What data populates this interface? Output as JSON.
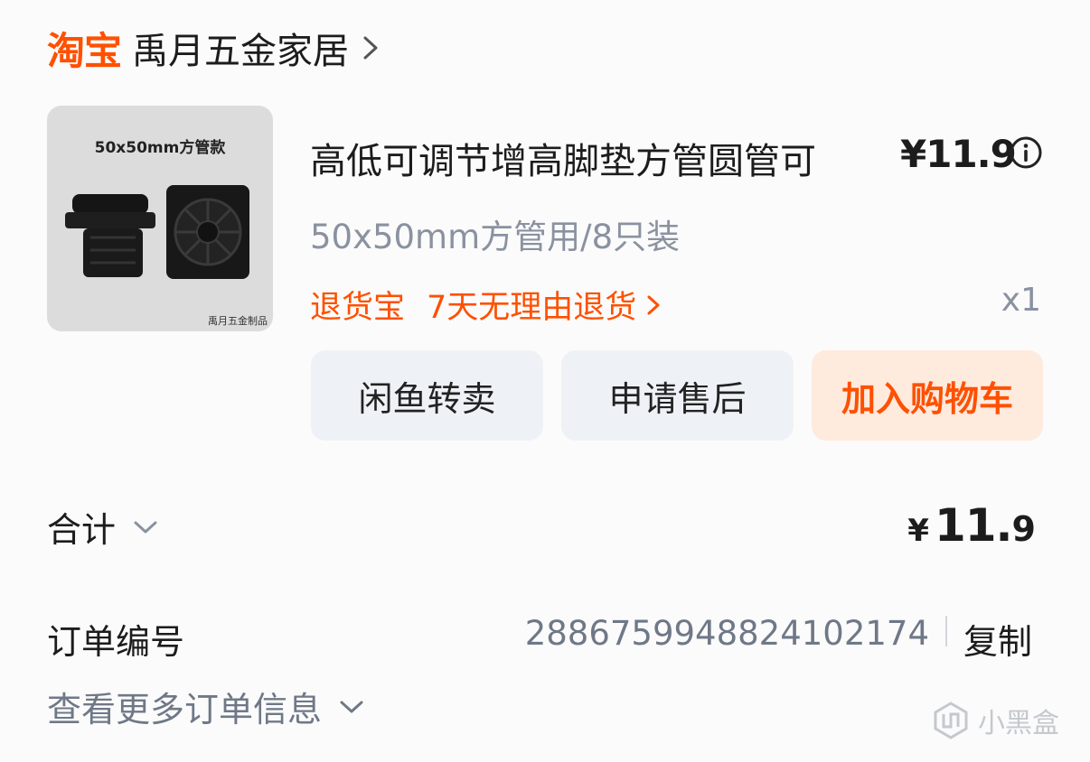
{
  "shop": {
    "brand": "淘宝",
    "name": "禹月五金家居"
  },
  "product": {
    "image_caption": "50x50mm方管款",
    "image_mark": "禹月五金制品",
    "title": "高低可调节增高脚垫方管圆管可",
    "price": "¥11.9",
    "spec": "50x50mm方管用/8只装",
    "return_guarantee": "退货宝",
    "return_policy": "7天无理由退货",
    "quantity": "x1"
  },
  "actions": {
    "resell": "闲鱼转卖",
    "after_sales": "申请售后",
    "add_to_cart": "加入购物车"
  },
  "summary": {
    "total_label": "合计",
    "currency": "¥",
    "total_int": "11.",
    "total_dec": "9",
    "order_no_label": "订单编号",
    "order_no": "2886759948824102174",
    "copy": "复制",
    "more_info": "查看更多订单信息"
  },
  "watermark": "小黑盒",
  "colors": {
    "accent": "#ff5000",
    "button_grey": "#eef2f6",
    "button_cart": "#ffeade",
    "muted_text": "#8a92a0"
  }
}
